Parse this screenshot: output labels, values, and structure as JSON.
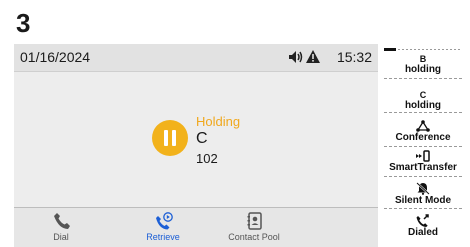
{
  "step_number": "3",
  "status_bar": {
    "date": "01/16/2024",
    "time": "15:32"
  },
  "call": {
    "status": "Holding",
    "name": "C",
    "number": "102"
  },
  "bottom_tabs": [
    {
      "label": "Dial",
      "icon": "phone-icon"
    },
    {
      "label": "Retrieve",
      "icon": "retrieve-call-icon",
      "active": true
    },
    {
      "label": "Contact Pool",
      "icon": "contact-book-icon"
    }
  ],
  "softkeys": [
    {
      "line1": "B",
      "line2": "holding"
    },
    {
      "line1": "C",
      "line2": "holding"
    },
    {
      "label": "Conference",
      "icon": "conference-icon"
    },
    {
      "label": "SmartTransfer",
      "icon": "transfer-icon"
    },
    {
      "label": "Silent Mode",
      "icon": "bell-off-icon"
    },
    {
      "label": "Dialed",
      "icon": "dialed-call-icon"
    }
  ],
  "colors": {
    "hold": "#f2b21b",
    "active_tab": "#1c5fd6"
  }
}
